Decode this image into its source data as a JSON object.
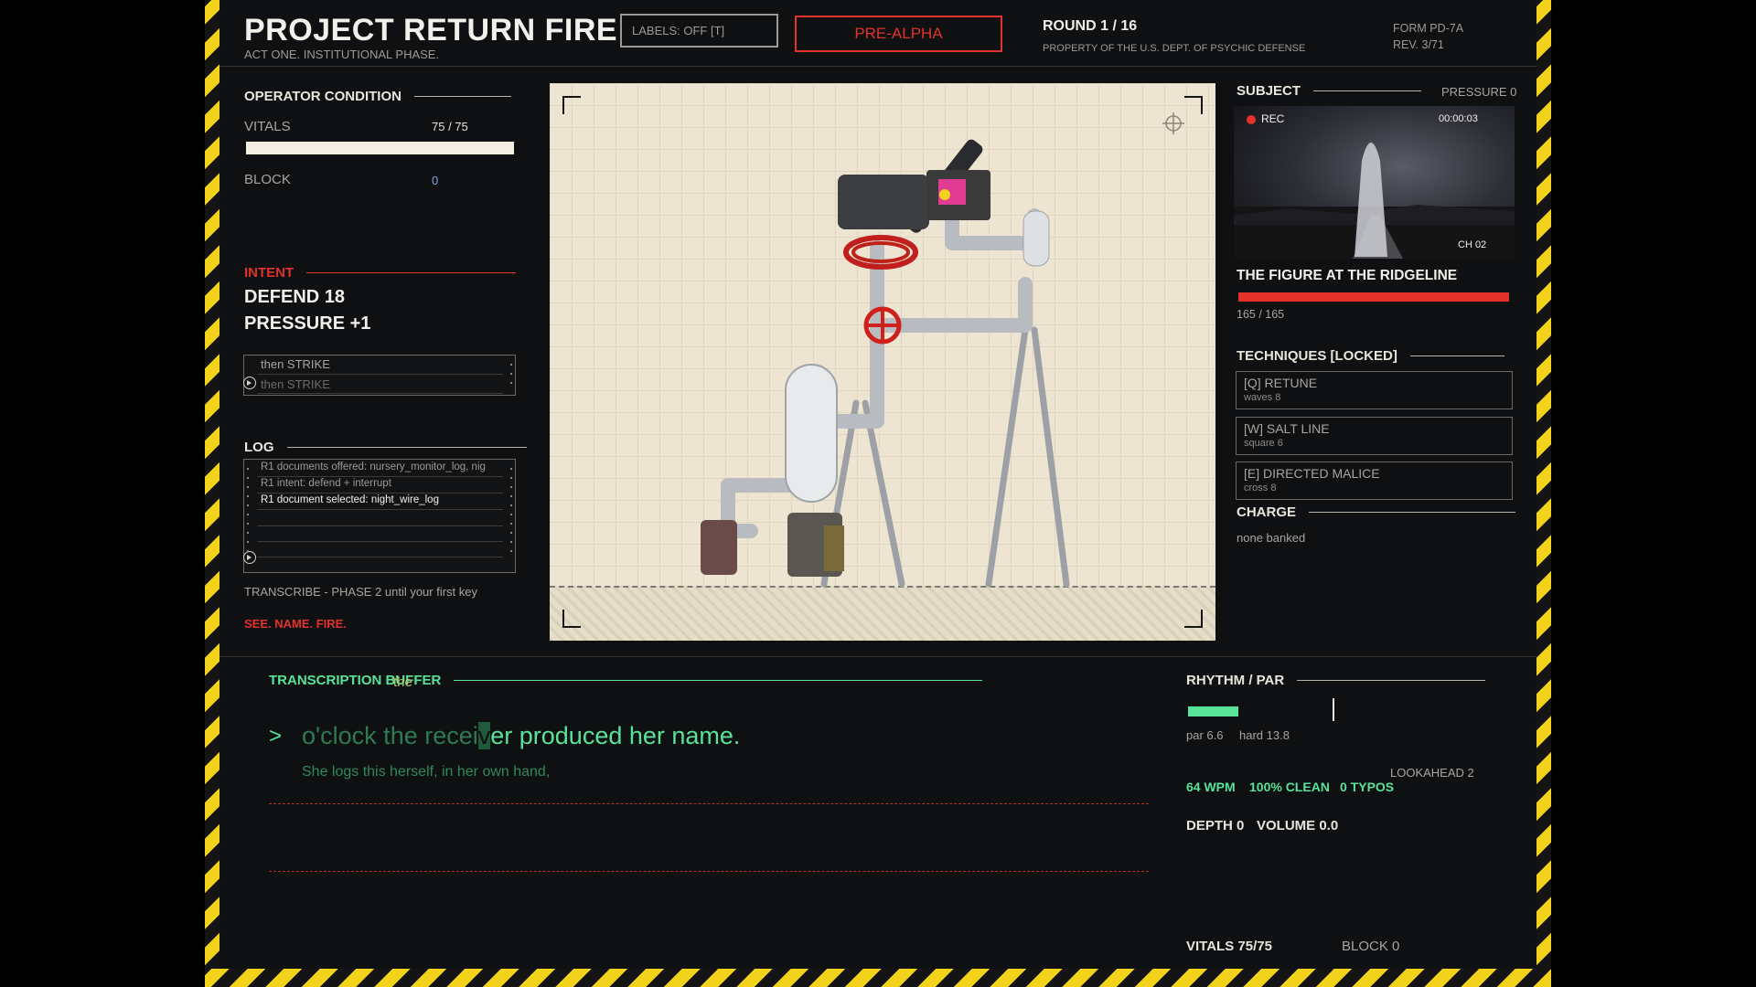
{
  "header": {
    "title": "PROJECT RETURN FIRE",
    "subtitle": "ACT ONE. INSTITUTIONAL PHASE.",
    "labels_toggle": "LABELS: OFF [T]",
    "build_badge": "PRE-ALPHA",
    "round": "ROUND 1 / 16",
    "property": "PROPERTY OF THE U.S. DEPT. OF PSYCHIC DEFENSE",
    "form": "FORM PD-7A",
    "rev": "REV. 3/71"
  },
  "operator": {
    "title": "OPERATOR CONDITION",
    "vitals_label": "VITALS",
    "vitals_value": "75 / 75",
    "vitals_fraction": 1.0,
    "block_label": "BLOCK",
    "block_value": "0"
  },
  "intent": {
    "title": "INTENT",
    "line1": "DEFEND 18",
    "line2": "PRESSURE +1",
    "queue": [
      "then STRIKE",
      "then STRIKE"
    ]
  },
  "log": {
    "title": "LOG",
    "entries": [
      "R1 documents offered: nursery_monitor_log, nig",
      "R1 intent: defend + interrupt",
      "R1 document selected: night_wire_log"
    ],
    "hint": "TRANSCRIBE - PHASE 2 until your first key",
    "motto": "SEE. NAME. FIRE."
  },
  "subject": {
    "title": "SUBJECT",
    "pressure": "PRESSURE 0",
    "rec": "REC",
    "timecode": "00:00:03",
    "channel": "CH 02",
    "name": "THE FIGURE AT THE RIDGELINE",
    "hp": "165 / 165",
    "hp_fraction": 1.0
  },
  "techniques": {
    "title": "TECHNIQUES  [LOCKED]",
    "items": [
      {
        "name": "[Q] RETUNE",
        "sub": "waves 8"
      },
      {
        "name": "[W] SALT LINE",
        "sub": "square 6"
      },
      {
        "name": "[E] DIRECTED MALICE",
        "sub": "cross 8"
      }
    ]
  },
  "charge": {
    "title": "CHARGE",
    "value": "none banked"
  },
  "transcription": {
    "title": "TRANSCRIPTION BUFFER",
    "ghost_word": "the",
    "prompt": ">",
    "typed": "o'clock the recei",
    "cursor": "v",
    "remaining": "er produced her name.",
    "next_line": "She logs this herself, in her own hand,"
  },
  "rhythm": {
    "title": "RHYTHM / PAR",
    "par": "par 6.6",
    "hard": "hard 13.8",
    "lookahead": "LOOKAHEAD 2",
    "wpm": "64 WPM",
    "clean": "100% CLEAN",
    "typos": "0 TYPOS",
    "depth": "DEPTH 0",
    "volume": "VOLUME 0.0",
    "vitals": "VITALS 75/75",
    "block": "BLOCK 0"
  },
  "colors": {
    "accent_red": "#e3312c",
    "accent_green": "#58e39a",
    "hazard_yellow": "#f2d21b",
    "panel_bg": "#0f1011"
  }
}
